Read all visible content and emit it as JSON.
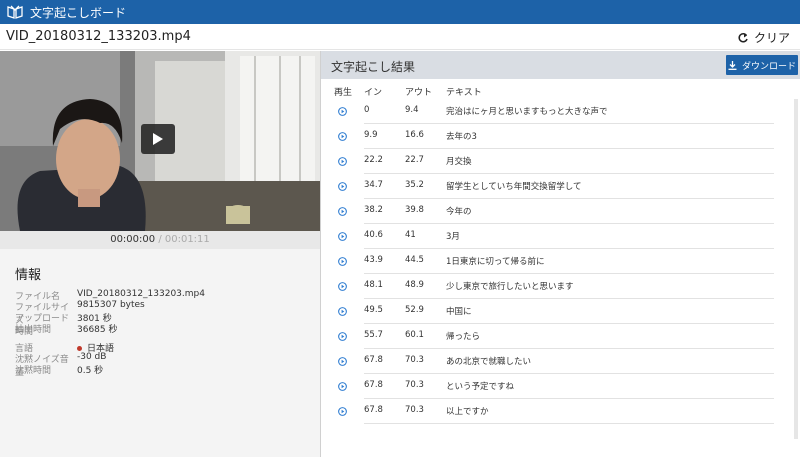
{
  "app": {
    "title": "文字起こしボード",
    "logo_icon": "book-icon"
  },
  "file": {
    "name": "VID_20180312_133203.mp4",
    "clear_label": "クリア",
    "clear_icon": "refresh-icon"
  },
  "player": {
    "current_time": "00:00:00",
    "total_time": "/ 00:01:11",
    "play_icon": "play-icon"
  },
  "info": {
    "title": "情報",
    "rows": [
      {
        "key": "ファイル名",
        "value": "VID_20180312_133203.mp4"
      },
      {
        "key": "ファイルサイズ",
        "value": "9815307 bytes"
      },
      {
        "key": "アップロード時間",
        "value": "3801 秒"
      },
      {
        "key": "抽出時間",
        "value": "36685 秒"
      }
    ],
    "settings": [
      {
        "key": "言語",
        "value": "日本語"
      },
      {
        "key": "沈黙ノイズ音量",
        "value": "-30 dB"
      },
      {
        "key": "沈黙時間",
        "value": "0.5 秒"
      }
    ]
  },
  "results": {
    "title": "文字起こし結果",
    "download_label": "ダウンロード",
    "download_icon": "download-icon",
    "columns": {
      "play": "再生",
      "in": "イン",
      "out": "アウト",
      "text": "テキスト"
    },
    "rows": [
      {
        "in": "0",
        "out": "9.4",
        "text": "完治はにヶ月と思いますもっと大きな声で"
      },
      {
        "in": "9.9",
        "out": "16.6",
        "text": "去年の3"
      },
      {
        "in": "22.2",
        "out": "22.7",
        "text": "月交換"
      },
      {
        "in": "34.7",
        "out": "35.2",
        "text": "留学生としていち年間交換留学して"
      },
      {
        "in": "38.2",
        "out": "39.8",
        "text": "今年の"
      },
      {
        "in": "40.6",
        "out": "41",
        "text": "3月"
      },
      {
        "in": "43.9",
        "out": "44.5",
        "text": "1日東京に切って帰る前に"
      },
      {
        "in": "48.1",
        "out": "48.9",
        "text": "少し東京で旅行したいと思います"
      },
      {
        "in": "49.5",
        "out": "52.9",
        "text": "中国に"
      },
      {
        "in": "55.7",
        "out": "60.1",
        "text": "帰ったら"
      },
      {
        "in": "67.8",
        "out": "70.3",
        "text": "あの北京で就職したい"
      },
      {
        "in": "67.8",
        "out": "70.3",
        "text": "という予定ですね"
      },
      {
        "in": "67.8",
        "out": "70.3",
        "text": "以上ですか"
      }
    ]
  }
}
